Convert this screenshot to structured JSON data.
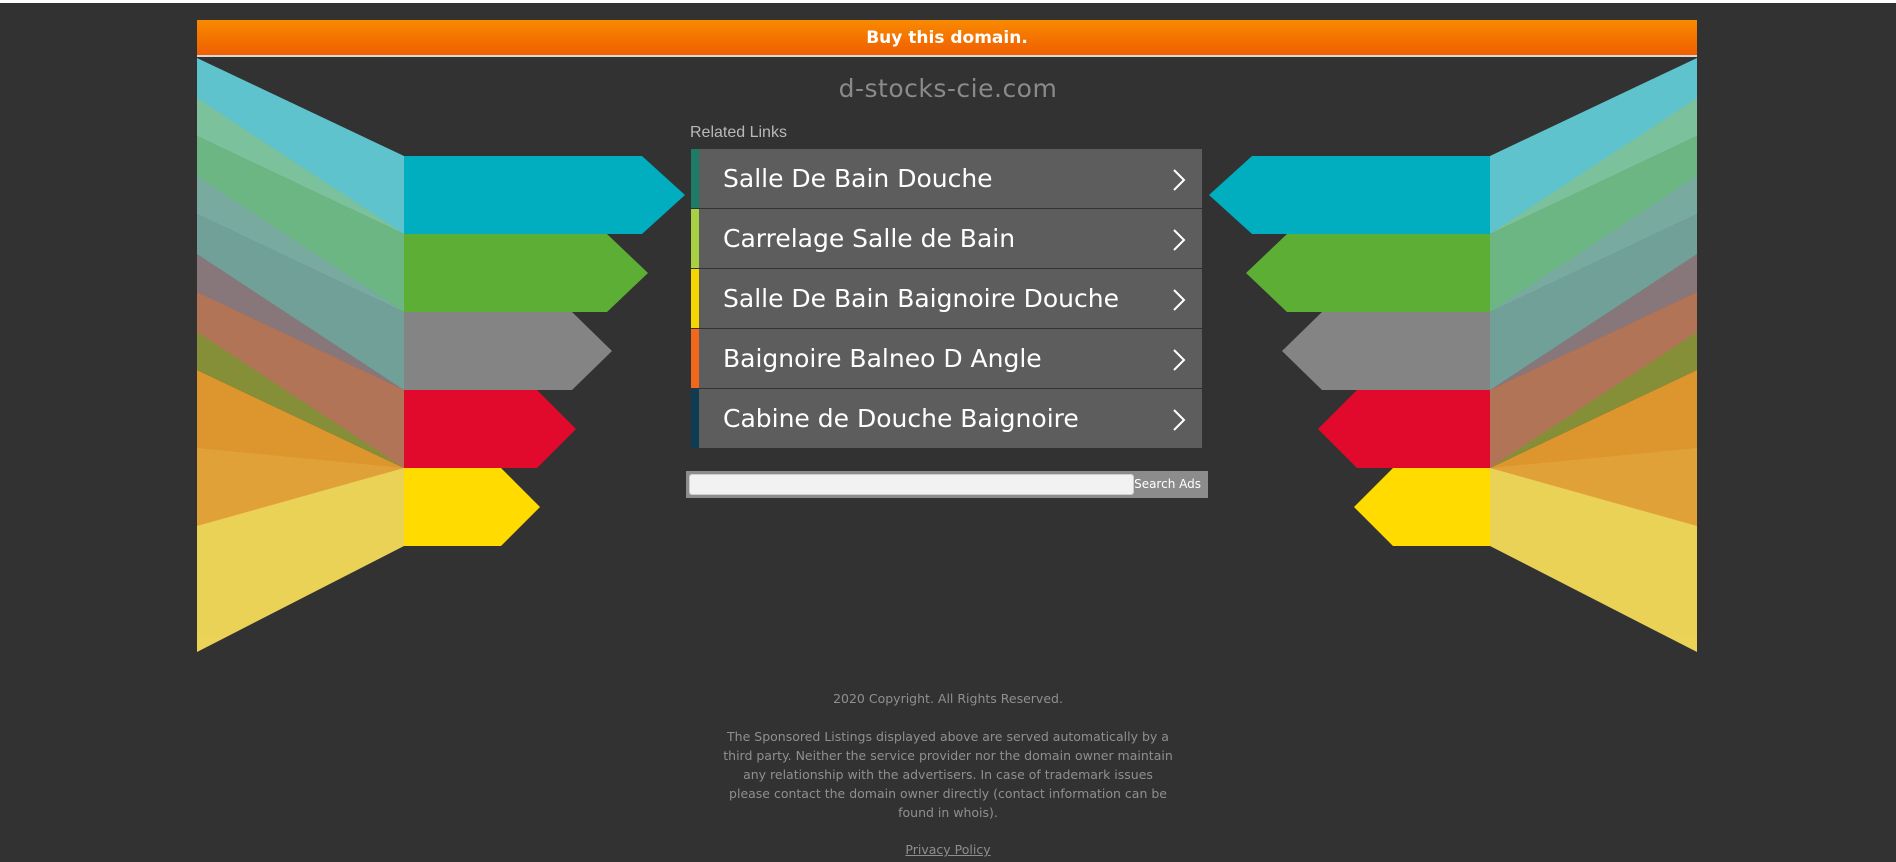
{
  "banner": {
    "text": "Buy this domain."
  },
  "site": {
    "domain": "d-stocks-cie.com"
  },
  "related": {
    "title": "Related Links",
    "links": [
      {
        "label": "Salle De Bain Douche",
        "accent": "#1d7b68"
      },
      {
        "label": "Carrelage Salle de Bain",
        "accent": "#a7d142"
      },
      {
        "label": "Salle De Bain Baignoire Douche",
        "accent": "#f6d600"
      },
      {
        "label": "Baignoire Balneo D Angle",
        "accent": "#f2681a"
      },
      {
        "label": "Cabine de Douche Baignoire",
        "accent": "#0f3c53"
      }
    ]
  },
  "search": {
    "button_label": "Search Ads",
    "value": ""
  },
  "footer": {
    "copyright": "2020 Copyright. All Rights Reserved.",
    "disclaimer": "The Sponsored Listings displayed above are served automatically by a third party. Neither the service provider nor the domain owner maintain any relationship with the advertisers. In case of trademark issues please contact the domain owner directly (contact information can be found in whois).",
    "privacy": "Privacy Policy"
  },
  "colors": {
    "background": "#323232",
    "banner_top": "#f98a00",
    "banner_bottom": "#ef5e00",
    "arrow_blue": "#00aec0",
    "arrow_green": "#5cae34",
    "arrow_gray": "#848484",
    "arrow_red": "#e20a2c",
    "arrow_yellow": "#ffdb00"
  },
  "icons": {
    "link_chevron": "chevron-right-icon"
  }
}
